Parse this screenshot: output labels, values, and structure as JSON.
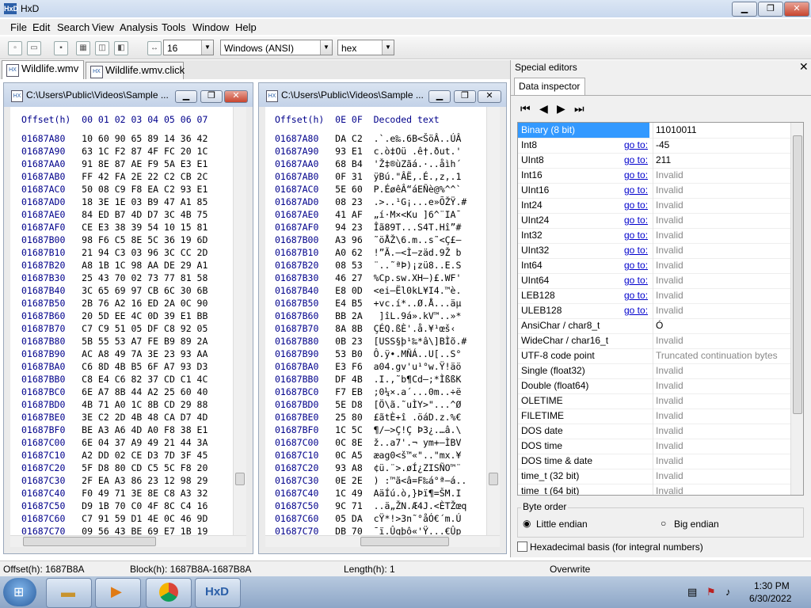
{
  "window": {
    "title": "HxD",
    "app_icon": "HxD"
  },
  "menu": [
    "File",
    "Edit",
    "Search",
    "View",
    "Analysis",
    "Tools",
    "Window",
    "Help"
  ],
  "toolbar": {
    "bytes_per_row": "16",
    "charset": "Windows (ANSI)",
    "display": "hex"
  },
  "tabs": [
    {
      "label": "Wildlife.wmv"
    },
    {
      "label": "Wildlife.wmv.click"
    }
  ],
  "editor_left": {
    "caption": "C:\\Users\\Public\\Videos\\Sample ...",
    "header": "Offset(h)  00 01 02 03 04 05 06 07",
    "rows": [
      [
        "01687A80",
        "10 60 90 65 89 14 36 42"
      ],
      [
        "01687A90",
        "63 1C F2 87 4F FC 20 1C"
      ],
      [
        "01687AA0",
        "91 8E 87 AE F9 5A E3 E1"
      ],
      [
        "01687AB0",
        "FF 42 FA 2E 22 C2 CB 2C"
      ],
      [
        "01687AC0",
        "50 08 C9 F8 EA C2 93 E1"
      ],
      [
        "01687AD0",
        "18 3E 1E 03 B9 47 A1 85"
      ],
      [
        "01687AE0",
        "84 ED B7 4D D7 3C 4B 75"
      ],
      [
        "01687AF0",
        "CE E3 38 39 54 10 15 81"
      ],
      [
        "01687B00",
        "98 F6 C5 8E 5C 36 19 6D"
      ],
      [
        "01687B10",
        "21 94 C3 03 96 3C CC 2D"
      ],
      [
        "01687B20",
        "A8 1B 1C 98 AA DE 29 A1"
      ],
      [
        "01687B30",
        "25 43 70 02 73 77 81 58"
      ],
      [
        "01687B40",
        "3C 65 69 97 CB 6C 30 6B"
      ],
      [
        "01687B50",
        "2B 76 A2 16 ED 2A 0C 90"
      ],
      [
        "01687B60",
        "20 5D EE 4C 0D 39 E1 BB"
      ],
      [
        "01687B70",
        "C7 C9 51 05 DF C8 92 05"
      ],
      [
        "01687B80",
        "5B 55 53 A7 FE B9 89 2A"
      ],
      [
        "01687B90",
        "AC A8 49 7A 3E 23 93 AA"
      ],
      [
        "01687BA0",
        "C6 8D 4B B5 6F A7 93 D3"
      ],
      [
        "01687BB0",
        "C8 E4 C6 82 37 CD C1 4C"
      ],
      [
        "01687BC0",
        "6E A7 8B 44 A2 25 60 40"
      ],
      [
        "01687BD0",
        "4B 71 A0 1C 8B CD 29 88"
      ],
      [
        "01687BE0",
        "3E C2 2D 4B 48 CA D7 4D"
      ],
      [
        "01687BF0",
        "BE A3 A6 4D A0 F8 38 E1"
      ],
      [
        "01687C00",
        "6E 04 37 A9 49 21 44 3A"
      ],
      [
        "01687C10",
        "A2 DD 02 CE D3 7D 3F 45"
      ],
      [
        "01687C20",
        "5F D8 80 CD C5 5C F8 20"
      ],
      [
        "01687C30",
        "2F EA A3 86 23 12 98 29"
      ],
      [
        "01687C40",
        "F0 49 71 3E 8E C8 A3 32"
      ],
      [
        "01687C50",
        "D9 1B 70 C0 4F 8C C4 16"
      ],
      [
        "01687C60",
        "C7 91 59 D1 4E 0C 46 9D"
      ],
      [
        "01687C70",
        "09 56 43 BE 69 E7 1B 19"
      ]
    ]
  },
  "editor_right": {
    "caption": "C:\\Users\\Public\\Videos\\Sample ...",
    "header": "Offset(h)  0E 0F  Decoded text",
    "rows": [
      [
        "01687A80",
        "DA C2",
        ".`.e‰.6B<ŠöÂ..ÚÂ"
      ],
      [
        "01687A90",
        "93 E1",
        "c.ò‡Oü .ê†.ðut.'"
      ],
      [
        "01687AA0",
        "68 B4",
        "'Ž‡®ùZãá.·..åìh´"
      ],
      [
        "01687AB0",
        "0F 31",
        "ÿBú.\"ÂË,.É.,z,.1"
      ],
      [
        "01687AC0",
        "5E 60",
        "P.ÉøêÂ“áEÑè@%^^`"
      ],
      [
        "01687AD0",
        "08 23",
        ".>..¹G¡...e»ÕŽŸ.#"
      ],
      [
        "01687AE0",
        "41 AF",
        "„í·M×<Ku ]6^¨IA¯"
      ],
      [
        "01687AF0",
        "94 23",
        "Îã89T...S4T.Hî”#"
      ],
      [
        "01687B00",
        "A3 96",
        "˜öÅŽ\\6.m..s˜<Ç£–"
      ],
      [
        "01687B10",
        "A0 62",
        "!”Ã.–<Ì–zäd.9Ž b"
      ],
      [
        "01687B20",
        "08 53",
        "¨..˜ªÞ)¡zü8..E.S"
      ],
      [
        "01687B30",
        "46 27",
        "%Cp.sw.XH–)£.WF'"
      ],
      [
        "01687B40",
        "E8 0D",
        "<ei—Ël0kL¥I4.™è."
      ],
      [
        "01687B50",
        "E4 B5",
        "+vc.í*..Ø.Å...äµ"
      ],
      [
        "01687B60",
        "BB 2A",
        " ]îL.9á».kV™..»*"
      ],
      [
        "01687B70",
        "8A 8B",
        "ÇÉQ.ßÈ'.å.¥¹œš‹"
      ],
      [
        "01687B80",
        "0B 23",
        "[USS§þ¹‰*â\\]BÌõ.#"
      ],
      [
        "01687B90",
        "53 B0",
        "Ô.ÿ•.MÑÁ..U[..S°"
      ],
      [
        "01687BA0",
        "E3 F6",
        "a04.gv'u¹°w.Ÿ!äö"
      ],
      [
        "01687BB0",
        "DF 4B",
        ".I.,˜b¶Cd–;*ÌßßK"
      ],
      [
        "01687BC0",
        "F7 EB",
        ";0¼×.a´...0m..÷ë"
      ],
      [
        "01687BD0",
        "5E D8",
        "[Ö\\ã.˜uÌY>\"...^Ø"
      ],
      [
        "01687BE0",
        "25 80",
        "£ãtÈ+î .öáD.z.%€"
      ],
      [
        "01687BF0",
        "1C 5C",
        "¶/—>Ç!Ç Þ3¿.…â.\\"
      ],
      [
        "01687C00",
        "0C 8E",
        "ž..a7'.¬ ym+–ÌBV"
      ],
      [
        "01687C10",
        "0C A5",
        "æag0<š™«\"..\"mx.¥"
      ],
      [
        "01687C20",
        "93 A8",
        "¢ü.¨>.øÍ¿ZISÑO™¨"
      ],
      [
        "01687C30",
        "0E 2E",
        ") :™ã<â=F‰á°ª–á.."
      ],
      [
        "01687C40",
        "1C 49",
        "AäÍú.ò,}Þï¶=ŠM.I"
      ],
      [
        "01687C50",
        "9C 71",
        "..ä„ŽN.Æ4J.<ÈTŽœq"
      ],
      [
        "01687C60",
        "05 DA",
        "cŸ*!>3n˜°åÓ€´m.Ú"
      ],
      [
        "01687C70",
        "DB 70",
        "¯ï.Ûqþô«'Ÿ...€Ûp"
      ]
    ]
  },
  "special_editors": {
    "title": "Special editors",
    "tab": "Data inspector",
    "goto_label": "go to:",
    "rows": [
      {
        "name": "Binary (8 bit)",
        "value": "11010011",
        "goto": false,
        "invalid": false,
        "selected": true
      },
      {
        "name": "Int8",
        "value": "-45",
        "goto": true,
        "invalid": false
      },
      {
        "name": "UInt8",
        "value": "211",
        "goto": true,
        "invalid": false
      },
      {
        "name": "Int16",
        "value": "Invalid",
        "goto": true,
        "invalid": true
      },
      {
        "name": "UInt16",
        "value": "Invalid",
        "goto": true,
        "invalid": true
      },
      {
        "name": "Int24",
        "value": "Invalid",
        "goto": true,
        "invalid": true
      },
      {
        "name": "UInt24",
        "value": "Invalid",
        "goto": true,
        "invalid": true
      },
      {
        "name": "Int32",
        "value": "Invalid",
        "goto": true,
        "invalid": true
      },
      {
        "name": "UInt32",
        "value": "Invalid",
        "goto": true,
        "invalid": true
      },
      {
        "name": "Int64",
        "value": "Invalid",
        "goto": true,
        "invalid": true
      },
      {
        "name": "UInt64",
        "value": "Invalid",
        "goto": true,
        "invalid": true
      },
      {
        "name": "LEB128",
        "value": "Invalid",
        "goto": true,
        "invalid": true
      },
      {
        "name": "ULEB128",
        "value": "Invalid",
        "goto": true,
        "invalid": true
      },
      {
        "name": "AnsiChar / char8_t",
        "value": "Ó",
        "goto": false,
        "invalid": false
      },
      {
        "name": "WideChar / char16_t",
        "value": "Invalid",
        "goto": false,
        "invalid": true
      },
      {
        "name": "UTF-8 code point",
        "value": "Truncated continuation bytes",
        "goto": false,
        "invalid": true
      },
      {
        "name": "Single (float32)",
        "value": "Invalid",
        "goto": false,
        "invalid": true
      },
      {
        "name": "Double (float64)",
        "value": "Invalid",
        "goto": false,
        "invalid": true
      },
      {
        "name": "OLETIME",
        "value": "Invalid",
        "goto": false,
        "invalid": true
      },
      {
        "name": "FILETIME",
        "value": "Invalid",
        "goto": false,
        "invalid": true
      },
      {
        "name": "DOS date",
        "value": "Invalid",
        "goto": false,
        "invalid": true
      },
      {
        "name": "DOS time",
        "value": "Invalid",
        "goto": false,
        "invalid": true
      },
      {
        "name": "DOS time & date",
        "value": "Invalid",
        "goto": false,
        "invalid": true
      },
      {
        "name": "time_t (32 bit)",
        "value": "Invalid",
        "goto": false,
        "invalid": true
      },
      {
        "name": "time_t (64 bit)",
        "value": "Invalid",
        "goto": false,
        "invalid": true
      }
    ],
    "byte_order_label": "Byte order",
    "little_endian": "Little endian",
    "big_endian": "Big endian",
    "hex_basis": "Hexadecimal basis (for integral numbers)"
  },
  "status": {
    "offset": "Offset(h): 1687B8A",
    "block": "Block(h): 1687B8A-1687B8A",
    "length": "Length(h): 1",
    "mode": "Overwrite"
  },
  "taskbar": {
    "time": "1:30 PM",
    "date": "6/30/2022"
  }
}
